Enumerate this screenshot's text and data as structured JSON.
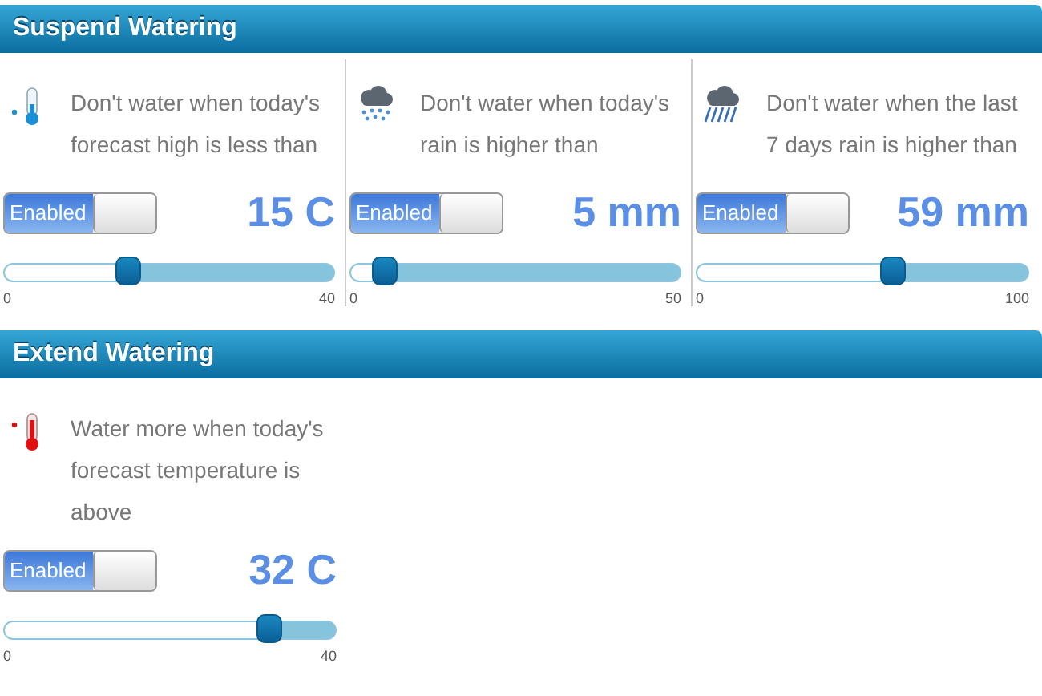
{
  "sections": [
    {
      "title": "Suspend Watering",
      "rules": [
        {
          "kind": "cold",
          "text": "Don't water when today's forecast high is less than",
          "toggle": {
            "label": "Enabled",
            "on": true
          },
          "value": "15 C",
          "level": 0.375,
          "min": "0",
          "max": "40"
        },
        {
          "kind": "rain",
          "text": "Don't water when today's rain is higher than",
          "toggle": {
            "label": "Enabled",
            "on": true
          },
          "value": "5 mm",
          "level": 0.1,
          "min": "0",
          "max": "50"
        },
        {
          "kind": "storm",
          "text": "Don't water when the last 7 days rain is higher than",
          "toggle": {
            "label": "Enabled",
            "on": true
          },
          "value": "59 mm",
          "level": 0.59,
          "min": "0",
          "max": "100"
        }
      ]
    },
    {
      "title": "Extend Watering",
      "rules": [
        {
          "kind": "hot",
          "text": "Water more when today's forecast temperature is above",
          "toggle": {
            "label": "Enabled",
            "on": true
          },
          "value": "32 C",
          "level": 0.8,
          "min": "0",
          "max": "40"
        }
      ]
    }
  ]
}
